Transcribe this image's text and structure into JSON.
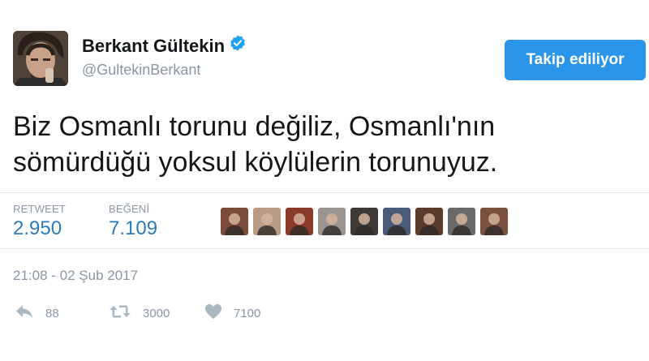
{
  "author": {
    "display_name": "Berkant Gültekin",
    "handle": "@GultekinBerkant",
    "verified_icon": "verified-badge-icon"
  },
  "follow_button": {
    "label": "Takip ediliyor",
    "color": "#2b95e9"
  },
  "tweet": {
    "line1": "Biz Osmanlı torunu değiliz, Osmanlı'nın",
    "line2": "sömürdüğü yoksul köylülerin torunuyuz."
  },
  "stats": {
    "retweet_label": "RETWEET",
    "retweet_value": "2.950",
    "like_label": "BEĞENİ",
    "like_value": "7.109"
  },
  "liker_avatars": [
    {
      "name": "liker-avatar-1",
      "color": "#7a4a3a"
    },
    {
      "name": "liker-avatar-2",
      "color": "#b99b86"
    },
    {
      "name": "liker-avatar-3",
      "color": "#8b3a2a"
    },
    {
      "name": "liker-avatar-4",
      "color": "#9a9590"
    },
    {
      "name": "liker-avatar-5",
      "color": "#3e3a38"
    },
    {
      "name": "liker-avatar-6",
      "color": "#4a5a78"
    },
    {
      "name": "liker-avatar-7",
      "color": "#5b3b2b"
    },
    {
      "name": "liker-avatar-8",
      "color": "#6a6a6a"
    },
    {
      "name": "liker-avatar-9",
      "color": "#7b5240"
    }
  ],
  "timestamp": "21:08 - 02 Şub 2017",
  "actions": {
    "reply_count": "88",
    "retweet_count": "3000",
    "like_count": "7100"
  },
  "colors": {
    "link_blue": "#2b7bb9",
    "muted": "#8a96a3",
    "divider": "#e1e8ed"
  }
}
